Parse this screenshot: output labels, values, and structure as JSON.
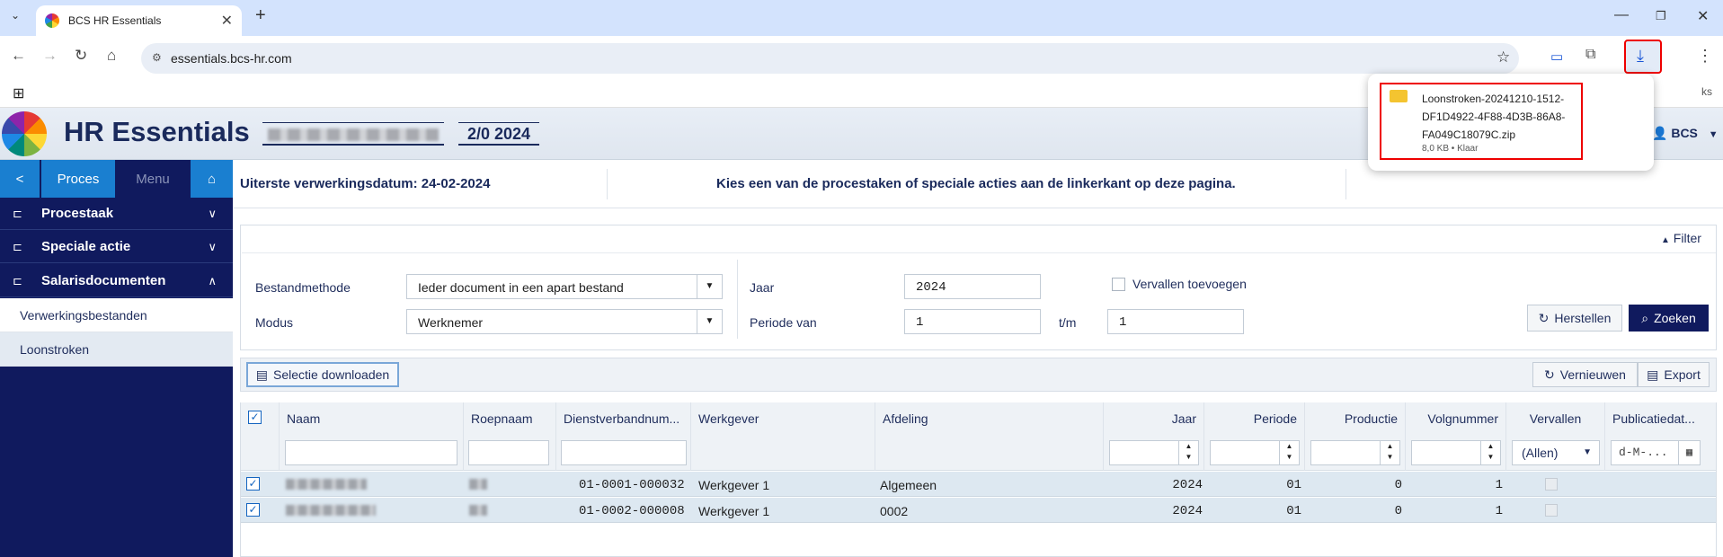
{
  "browser": {
    "tab_title": "BCS HR Essentials",
    "url": "essentials.bcs-hr.com",
    "new_tab": "+",
    "bookmarks_trail": "ks"
  },
  "download": {
    "filename": "Loonstroken-20241210-1512-DF1D4922-4F88-4D3B-86A8-FA049C18079C.zip",
    "fn_line1": "Loonstroken-20241210-1512-",
    "fn_line2": "DF1D4922-4F88-4D3B-86A8-",
    "fn_line3": "FA049C18079C.zip",
    "status": "8,0 KB • Klaar"
  },
  "app": {
    "title": "HR Essentials",
    "period": "2/0 2024",
    "user": "BCS",
    "accent": "#101a5e"
  },
  "sidebar": {
    "back": "<",
    "proces": "Proces",
    "menu": "Menu",
    "items": [
      {
        "label": "Procestaak"
      },
      {
        "label": "Speciale actie"
      },
      {
        "label": "Salarisdocumenten"
      }
    ],
    "sub": [
      "Verwerkingsbestanden",
      "Loonstroken"
    ]
  },
  "info": {
    "deadline": "Uiterste verwerkingsdatum: 24-02-2024",
    "message": "Kies een van de procestaken of speciale acties aan de linkerkant op deze pagina."
  },
  "filter": {
    "toggle": "Filter",
    "bestandmethode_label": "Bestandmethode",
    "bestandmethode_value": "Ieder document in een apart bestand",
    "modus_label": "Modus",
    "modus_value": "Werknemer",
    "jaar_label": "Jaar",
    "jaar_value": "2024",
    "periode_label": "Periode van",
    "periode_van": "1",
    "tm_label": "t/m",
    "periode_tm": "1",
    "vervallen_label": "Vervallen toevoegen",
    "herstellen": "Herstellen",
    "zoeken": "Zoeken"
  },
  "toolbar": {
    "download": "Selectie downloaden",
    "vernieuwen": "Vernieuwen",
    "export": "Export"
  },
  "grid": {
    "columns": [
      "Naam",
      "Roepnaam",
      "Dienstverbandnum...",
      "Werkgever",
      "Afdeling",
      "Jaar",
      "Periode",
      "Productie",
      "Volgnummer",
      "Vervallen",
      "Publicatiedat..."
    ],
    "vervallen_filter": "(Allen)",
    "date_placeholder": "d-M-...",
    "rows": [
      {
        "dienst": "01-0001-000032",
        "werkgever": "Werkgever 1",
        "afdeling": "Algemeen",
        "jaar": "2024",
        "periode": "01",
        "productie": "0",
        "volgnummer": "1"
      },
      {
        "dienst": "01-0002-000008",
        "werkgever": "Werkgever 1",
        "afdeling": "0002",
        "jaar": "2024",
        "periode": "01",
        "productie": "0",
        "volgnummer": "1"
      }
    ]
  }
}
